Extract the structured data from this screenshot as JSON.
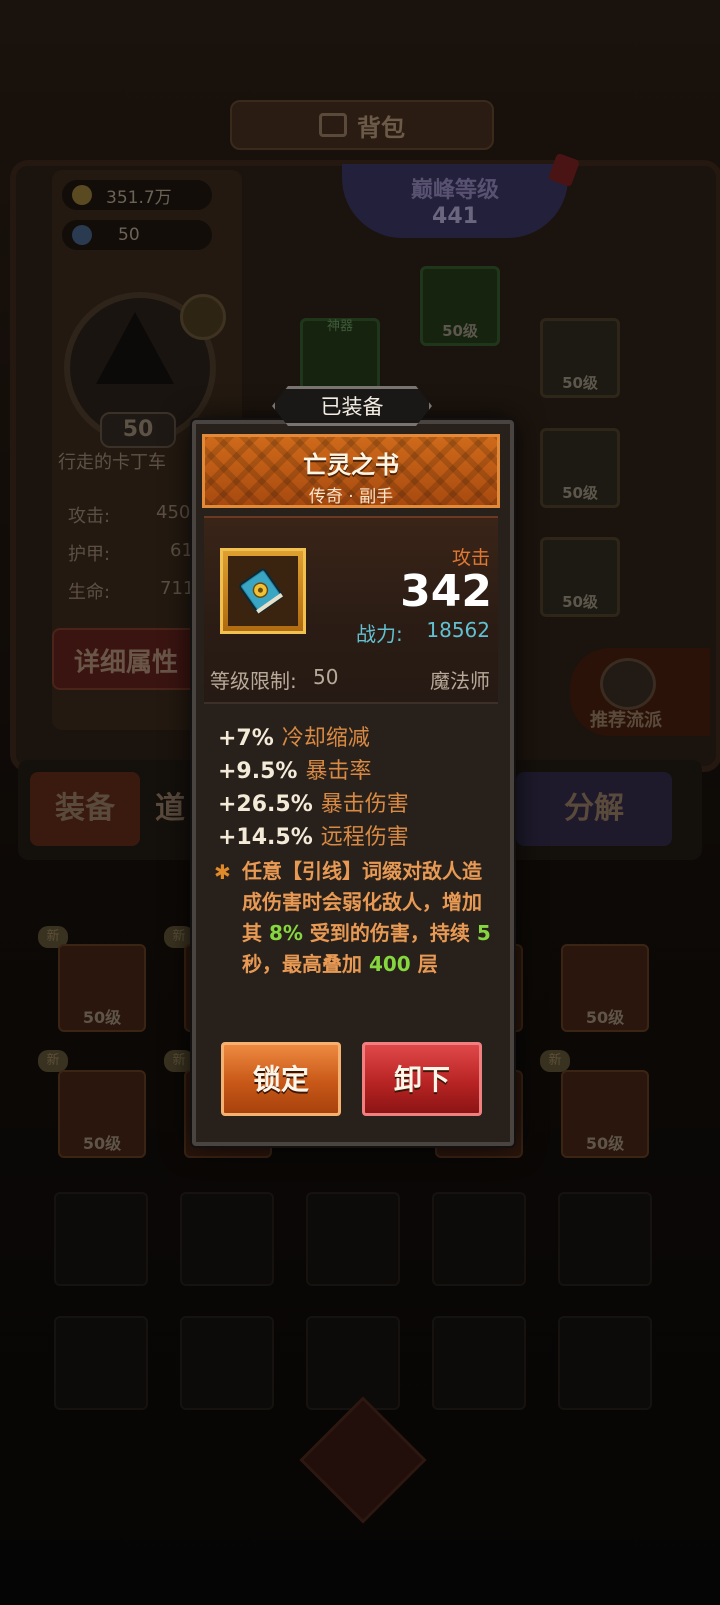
{
  "background": {
    "title": "背包",
    "gold": "351.7万",
    "gems": "50",
    "avatar_level": "50",
    "character_name": "行走的卡丁车",
    "stats": [
      {
        "label": "攻击:",
        "value": "450"
      },
      {
        "label": "护甲:",
        "value": "61"
      },
      {
        "label": "生命:",
        "value": "711"
      }
    ],
    "detail_button": "详细属性",
    "peak": {
      "label": "巅峰等级",
      "value": "441"
    },
    "slot_level": "50级",
    "slot_tag": "神器",
    "recommend": "推荐流派",
    "tabs": {
      "equip": "装备",
      "items": "道",
      "decompose": "分解"
    },
    "new_tag": "新"
  },
  "popup": {
    "equipped_tag": "已装备",
    "item_name": "亡灵之书",
    "item_type": "传奇 · 副手",
    "attack_label": "攻击",
    "attack_value": "342",
    "power_label": "战力:",
    "power_value": "18562",
    "level_req_label": "等级限制:",
    "level_req_value": "50",
    "class": "魔法师",
    "stats": [
      {
        "value": "+7%",
        "name": "冷却缩减"
      },
      {
        "value": "+9.5%",
        "name": "暴击率"
      },
      {
        "value": "+26.5%",
        "name": "暴击伤害"
      },
      {
        "value": "+14.5%",
        "name": "远程伤害"
      }
    ],
    "special": {
      "p1": "任意【引线】词缀对敌人造成伤害时会弱化敌人，增加其",
      "v1": "8%",
      "p2": "受到的伤害，持续",
      "v2": "5",
      "p3": "秒，最高叠加",
      "v3": "400",
      "p4": "层"
    },
    "lock_button": "锁定",
    "unequip_button": "卸下"
  },
  "colors": {
    "orange_banner": "#c85a14",
    "attack_orange": "#e07832",
    "power_cyan": "#62c0d0",
    "highlight_green": "#86d640",
    "lock_button": "#d8621c",
    "unequip_button": "#c02c2c"
  }
}
